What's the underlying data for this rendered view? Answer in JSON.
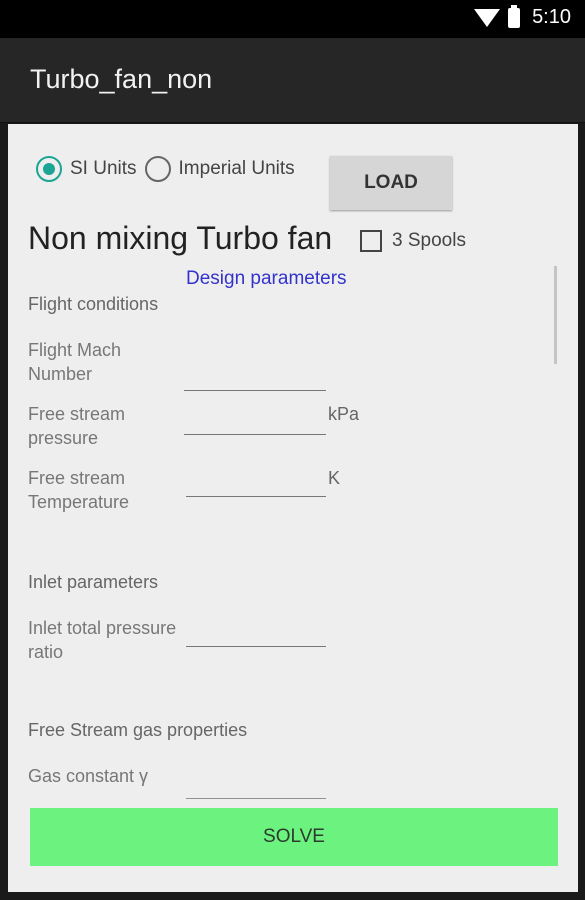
{
  "status_bar": {
    "time": "5:10",
    "icons": [
      "wifi-icon",
      "battery-icon"
    ]
  },
  "app_bar": {
    "title": "Turbo_fan_non"
  },
  "units": {
    "si_label": "SI Units",
    "imperial_label": "Imperial Units",
    "selected": "SI Units"
  },
  "load_button": "LOAD",
  "header": {
    "title": "Non mixing Turbo fan",
    "spools_label": "3 Spools",
    "spools_checked": false
  },
  "design_parameters_link": "Design parameters",
  "sections": {
    "flight": "Flight conditions",
    "inlet": "Inlet parameters",
    "gas": "Free Stream gas properties"
  },
  "fields": {
    "mach": {
      "label": "Flight Mach Number",
      "value": ""
    },
    "pressure": {
      "label": "Free stream pressure",
      "value": "",
      "unit": "kPa"
    },
    "temperature": {
      "label": "Free stream Temperature",
      "value": "",
      "unit": "K"
    },
    "inlet_ratio": {
      "label": "Inlet total pressure ratio",
      "value": ""
    },
    "gas_constant": {
      "label": "Gas constant γ",
      "value": ""
    }
  },
  "solve_button": "SOLVE",
  "colors": {
    "accent": "#1aa594",
    "solve": "#6cf27f",
    "link": "#3333cc"
  }
}
